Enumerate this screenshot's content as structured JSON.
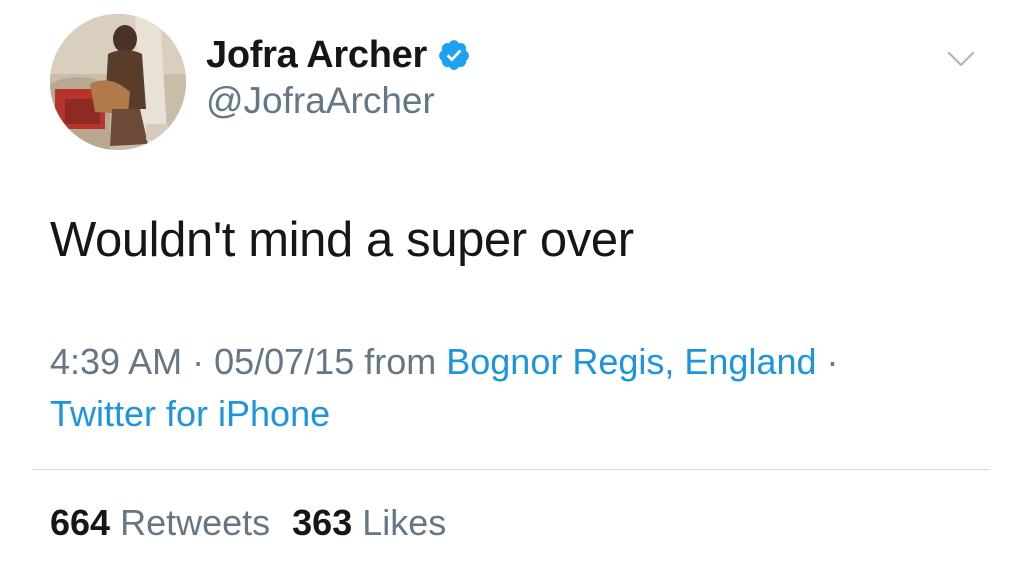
{
  "author": {
    "display_name": "Jofra Archer",
    "handle": "@JofraArcher",
    "verified": true
  },
  "tweet": {
    "text": "Wouldn't mind a super over"
  },
  "meta": {
    "time": "4:39 AM",
    "separator": " · ",
    "date": "05/07/15",
    "from_label": " from ",
    "location": "Bognor Regis, England",
    "trailing_separator": " ·",
    "source": "Twitter for iPhone"
  },
  "stats": {
    "retweets_count": "664",
    "retweets_label": " Retweets",
    "likes_count": "363",
    "likes_label": " Likes"
  },
  "colors": {
    "link": "#1b95e0",
    "muted": "#657786",
    "text": "#14171a",
    "verified": "#1da1f2"
  },
  "icons": {
    "verified": "verified-badge-icon",
    "menu": "chevron-down-icon"
  }
}
